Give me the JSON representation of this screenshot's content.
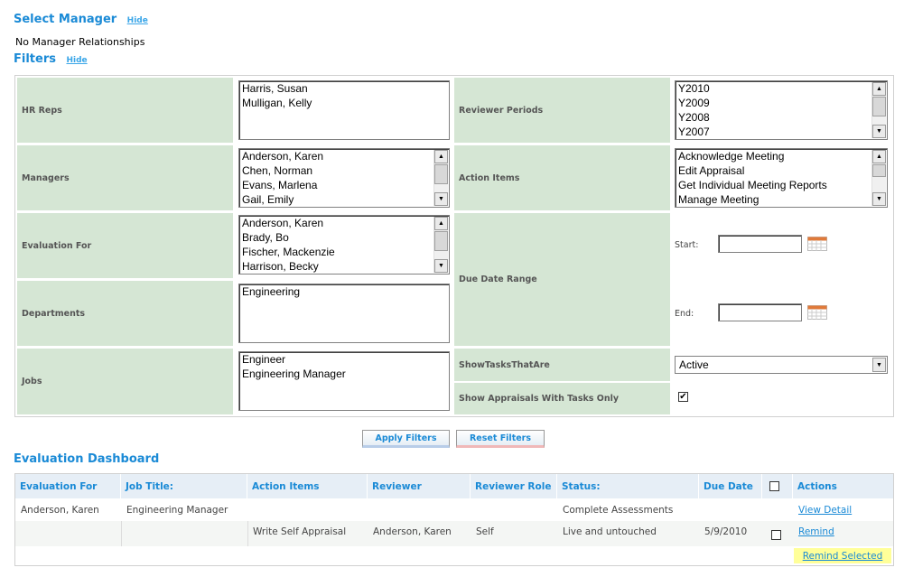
{
  "select_manager": {
    "title": "Select Manager",
    "hide": "Hide",
    "message": "No Manager Relationships"
  },
  "filters": {
    "title": "Filters",
    "hide": "Hide",
    "hr_reps": {
      "label": "HR Reps",
      "options": [
        "Harris, Susan",
        "Mulligan, Kelly"
      ]
    },
    "reviewer_periods": {
      "label": "Reviewer Periods",
      "options": [
        "Y2010",
        "Y2009",
        "Y2008",
        "Y2007"
      ]
    },
    "managers": {
      "label": "Managers",
      "options": [
        "Anderson, Karen",
        "Chen, Norman",
        "Evans, Marlena",
        "Gail, Emily"
      ]
    },
    "action_items": {
      "label": "Action Items",
      "options": [
        "Acknowledge Meeting",
        "Edit Appraisal",
        "Get Individual Meeting Reports",
        "Manage Meeting"
      ]
    },
    "evaluation_for": {
      "label": "Evaluation For",
      "options": [
        "Anderson, Karen",
        "Brady, Bo",
        "Fischer, Mackenzie",
        "Harrison, Becky"
      ]
    },
    "due_date_range": {
      "label": "Due Date Range",
      "start_label": "Start:",
      "end_label": "End:",
      "start_value": "",
      "end_value": ""
    },
    "departments": {
      "label": "Departments",
      "options": [
        "Engineering"
      ]
    },
    "jobs": {
      "label": "Jobs",
      "options": [
        "Engineer",
        "Engineering Manager"
      ]
    },
    "show_tasks": {
      "label": "ShowTasksThatAre",
      "selected": "Active"
    },
    "show_appraisals": {
      "label": "Show Appraisals With Tasks Only",
      "checked": "✔"
    },
    "apply_button": "Apply Filters",
    "reset_button": "Reset Filters"
  },
  "dashboard": {
    "title": "Evaluation Dashboard",
    "columns": [
      "Evaluation For",
      "Job Title:",
      "Action Items",
      "Reviewer",
      "Reviewer Role",
      "Status:",
      "Due Date",
      "",
      "Actions"
    ],
    "rows": [
      {
        "evaluation_for": "Anderson, Karen",
        "job_title": "Engineering Manager",
        "action_items": "",
        "reviewer": "",
        "reviewer_role": "",
        "status": "Complete Assessments",
        "due_date": "",
        "action": "View Detail"
      },
      {
        "evaluation_for": "",
        "job_title": "",
        "action_items": "Write Self Appraisal",
        "reviewer": "Anderson, Karen",
        "reviewer_role": "Self",
        "status": "Live and untouched",
        "due_date": "5/9/2010",
        "action": "Remind"
      }
    ],
    "remind_selected": "Remind Selected"
  },
  "colors": {
    "accent": "#1a8ad6",
    "label_bg": "#d5e6d4",
    "header_bg": "#e6eef6",
    "highlight": "#ffff99"
  }
}
